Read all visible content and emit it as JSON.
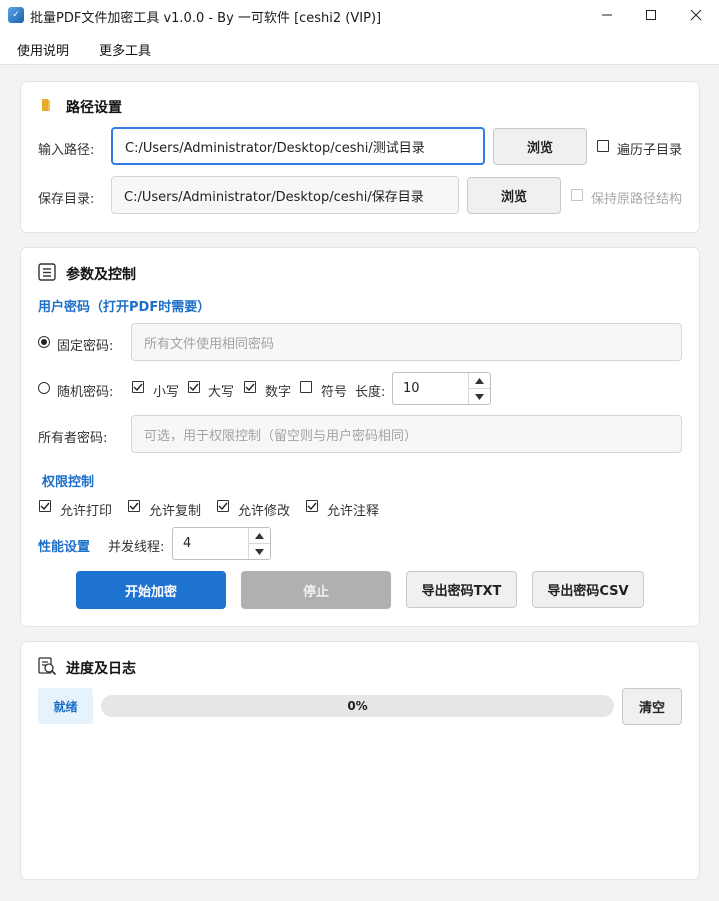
{
  "window": {
    "title": "批量PDF文件加密工具 v1.0.0 - By 一可软件 [ceshi2 (VIP)]",
    "app_icon": "app-icon"
  },
  "menu": {
    "items": [
      "使用说明",
      "更多工具"
    ]
  },
  "path_section": {
    "title": "路径设置",
    "icon": "folder-icon",
    "input_label": "输入路径:",
    "input_value": "C:/Users/Administrator/Desktop/ceshi/测试目录",
    "browse_label": "浏览",
    "traverse_label": "遍历子目录",
    "traverse_checked": false,
    "save_label": "保存目录:",
    "save_value": "C:/Users/Administrator/Desktop/ceshi/保存目录",
    "keep_structure_label": "保持原路径结构",
    "keep_structure_checked": false
  },
  "params_section": {
    "title": "参数及控制",
    "icon": "list-icon",
    "user_password_heading": "用户密码（打开PDF时需要）",
    "fixed_password_label": "固定密码:",
    "fixed_password_selected": true,
    "fixed_password_placeholder": "所有文件使用相同密码",
    "random_password_label": "随机密码:",
    "random_password_selected": false,
    "opt_lower": "小写",
    "opt_lower_checked": true,
    "opt_upper": "大写",
    "opt_upper_checked": true,
    "opt_digit": "数字",
    "opt_digit_checked": true,
    "opt_symbol": "符号",
    "opt_symbol_checked": false,
    "length_label": "长度:",
    "length_value": "10",
    "owner_password_label": "所有者密码:",
    "owner_password_placeholder": "可选，用于权限控制（留空则与用户密码相同）",
    "permissions_heading": "权限控制",
    "perm_print": "允许打印",
    "perm_print_checked": true,
    "perm_copy": "允许复制",
    "perm_copy_checked": true,
    "perm_modify": "允许修改",
    "perm_modify_checked": true,
    "perm_annotate": "允许注释",
    "perm_annotate_checked": true,
    "performance_heading": "性能设置",
    "threads_label": "并发线程:",
    "threads_value": "4",
    "start_button": "开始加密",
    "stop_button": "停止",
    "export_txt_button": "导出密码TXT",
    "export_csv_button": "导出密码CSV"
  },
  "progress_section": {
    "title": "进度及日志",
    "icon": "log-icon",
    "status": "就绪",
    "progress_text": "0%",
    "progress_fraction": 0,
    "clear_button": "清空"
  },
  "colors": {
    "accent": "#1e72d0",
    "heading_blue": "#1e6fc8",
    "focus_border": "#2f7de1"
  }
}
